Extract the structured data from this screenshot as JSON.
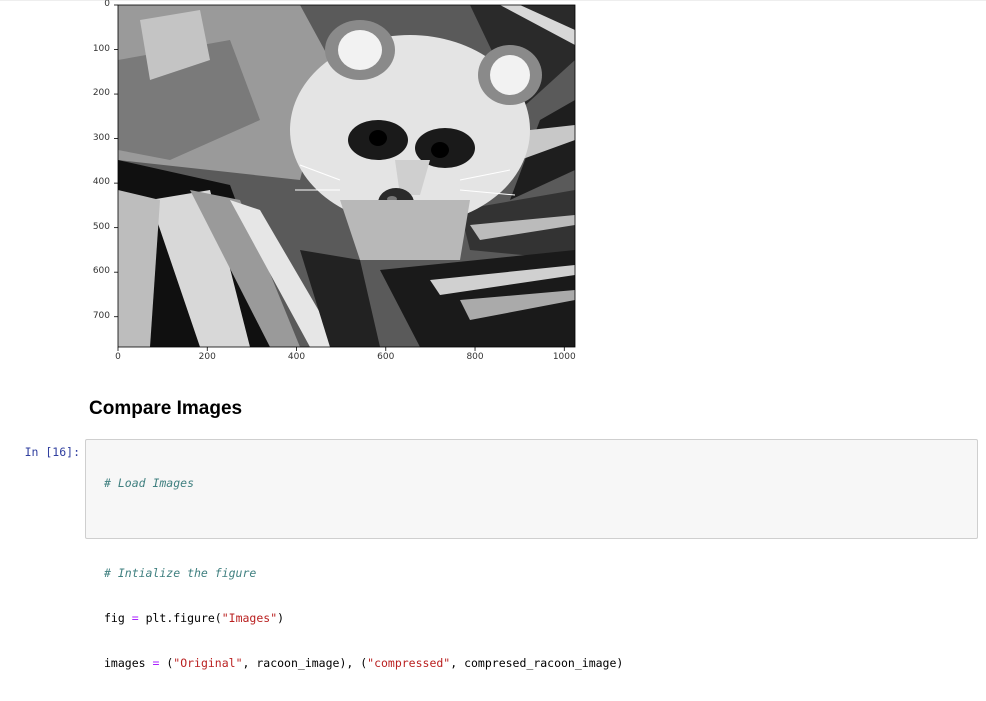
{
  "output_figure": {
    "image_description": "racoon-image",
    "yticks": [
      "0",
      "100",
      "200",
      "300",
      "400",
      "500",
      "600",
      "700"
    ],
    "xticks": [
      "0",
      "200",
      "400",
      "600",
      "800",
      "1000"
    ]
  },
  "markdown": {
    "heading": "Compare Images"
  },
  "cell": {
    "prompt": "In [16]:",
    "code": {
      "comment1": "# Load Images",
      "comment2": "# Intialize the figure",
      "line_fig_a": "fig ",
      "line_fig_b": "=",
      "line_fig_c": " plt.figure(",
      "line_fig_str": "\"Images\"",
      "line_fig_d": ")",
      "line_img_a": "images ",
      "line_img_b": "=",
      "line_img_c": " (",
      "line_img_str1": "\"Original\"",
      "line_img_d": ", racoon_image), (",
      "line_img_str2": "\"compressed\"",
      "line_img_e": ", compresed_racoon_image)"
    }
  },
  "colors": {
    "prompt": "#303f9f",
    "comment": "#408080",
    "string": "#ba2121",
    "operator": "#aa22ff"
  }
}
